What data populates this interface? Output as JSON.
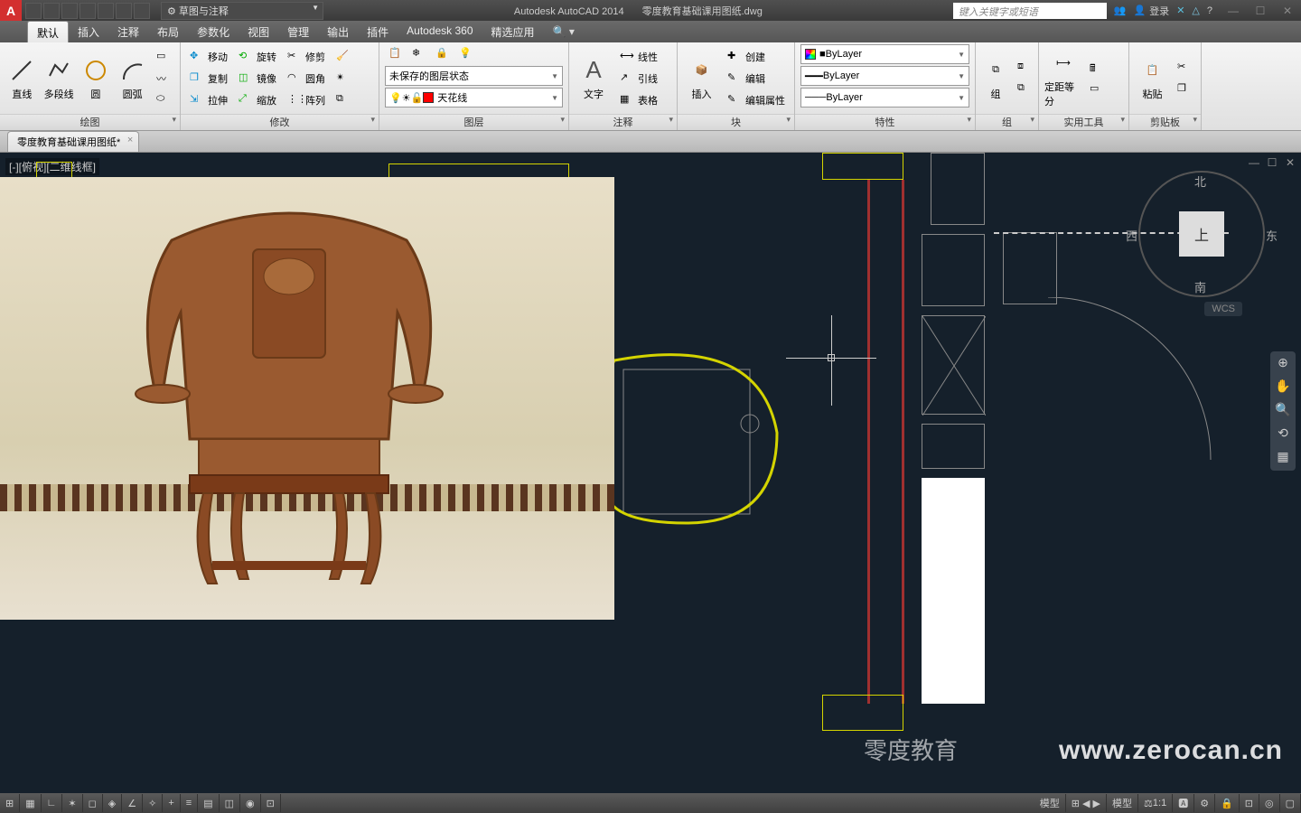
{
  "title": {
    "app": "Autodesk AutoCAD 2014",
    "doc": "零度教育基础课用图纸.dwg"
  },
  "workspace": "草图与注释",
  "search_placeholder": "键入关键字或短语",
  "login": "登录",
  "menu_tabs": [
    "默认",
    "插入",
    "注释",
    "布局",
    "参数化",
    "视图",
    "管理",
    "输出",
    "插件",
    "Autodesk 360",
    "精选应用"
  ],
  "panels": {
    "draw": {
      "label": "绘图",
      "items": [
        "直线",
        "多段线",
        "圆",
        "圆弧"
      ]
    },
    "modify": {
      "label": "修改",
      "items": [
        "移动",
        "复制",
        "拉伸",
        "旋转",
        "镜像",
        "缩放",
        "修剪",
        "圆角",
        "阵列"
      ]
    },
    "layer": {
      "label": "图层",
      "state": "未保存的图层状态",
      "current": "天花线"
    },
    "anno": {
      "label": "注释",
      "text": "文字",
      "items": [
        "线性",
        "引线",
        "表格"
      ]
    },
    "block": {
      "label": "块",
      "insert": "插入",
      "items": [
        "创建",
        "编辑",
        "编辑属性"
      ]
    },
    "prop": {
      "label": "特性",
      "color": "ByLayer",
      "lw": "ByLayer",
      "lt": "ByLayer"
    },
    "group": {
      "label": "组",
      "btn": "组"
    },
    "util": {
      "label": "实用工具",
      "measure": "定距等分"
    },
    "clip": {
      "label": "剪贴板",
      "paste": "粘贴"
    }
  },
  "filetab": "零度教育基础课用图纸*",
  "viewport": "[-][俯视][二维线框]",
  "viewcube": {
    "top": "上",
    "n": "北",
    "s": "南",
    "w": "西",
    "e": "东",
    "wcs": "WCS"
  },
  "statusbar": {
    "layout_tabs": [
      "模型"
    ],
    "scale": "1:1",
    "right_items": [
      "模型"
    ]
  },
  "watermark": "www.zerocan.cn",
  "watermark_cn": "零度教育"
}
